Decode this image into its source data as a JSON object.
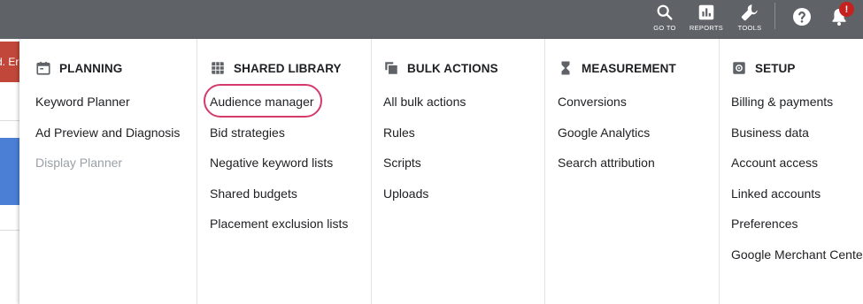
{
  "topbar": {
    "tools": [
      {
        "label": "GO TO",
        "icon": "search-icon"
      },
      {
        "label": "REPORTS",
        "icon": "reports-icon"
      },
      {
        "label": "TOOLS",
        "icon": "wrench-icon"
      }
    ],
    "help_icon": "help-icon",
    "notifications_icon": "bell-icon",
    "notification_badge": "!"
  },
  "background": {
    "partial_text": "d. Er"
  },
  "menu": {
    "columns": [
      {
        "title": "PLANNING",
        "icon": "calendar-icon",
        "items": [
          {
            "label": "Keyword Planner",
            "enabled": true
          },
          {
            "label": "Ad Preview and Diagnosis",
            "enabled": true
          },
          {
            "label": "Display Planner",
            "enabled": false
          }
        ]
      },
      {
        "title": "SHARED LIBRARY",
        "icon": "library-grid-icon",
        "items": [
          {
            "label": "Audience manager",
            "enabled": true,
            "highlighted": true
          },
          {
            "label": "Bid strategies",
            "enabled": true
          },
          {
            "label": "Negative keyword lists",
            "enabled": true
          },
          {
            "label": "Shared budgets",
            "enabled": true
          },
          {
            "label": "Placement exclusion lists",
            "enabled": true
          }
        ]
      },
      {
        "title": "BULK ACTIONS",
        "icon": "copy-stack-icon",
        "items": [
          {
            "label": "All bulk actions",
            "enabled": true
          },
          {
            "label": "Rules",
            "enabled": true
          },
          {
            "label": "Scripts",
            "enabled": true
          },
          {
            "label": "Uploads",
            "enabled": true
          }
        ]
      },
      {
        "title": "MEASUREMENT",
        "icon": "hourglass-icon",
        "items": [
          {
            "label": "Conversions",
            "enabled": true
          },
          {
            "label": "Google Analytics",
            "enabled": true
          },
          {
            "label": "Search attribution",
            "enabled": true
          }
        ]
      },
      {
        "title": "SETUP",
        "icon": "settings-icon",
        "items": [
          {
            "label": "Billing & payments",
            "enabled": true
          },
          {
            "label": "Business data",
            "enabled": true
          },
          {
            "label": "Account access",
            "enabled": true
          },
          {
            "label": "Linked accounts",
            "enabled": true
          },
          {
            "label": "Preferences",
            "enabled": true
          },
          {
            "label": "Google Merchant Center",
            "enabled": true
          }
        ]
      }
    ]
  },
  "colors": {
    "topbar": "#5f6368",
    "highlight_ring": "#d63a6a",
    "disabled_text": "#9aa0a6",
    "badge": "#c5221f"
  }
}
